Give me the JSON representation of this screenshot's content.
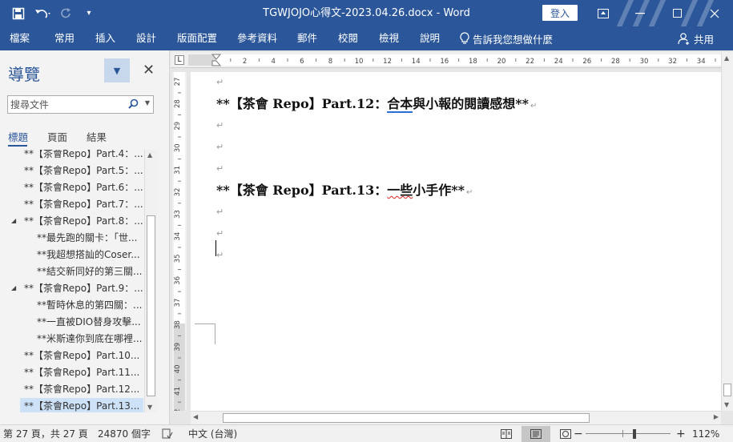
{
  "titlebar": {
    "title": "TGWJOJO心得文-2023.04.26.docx  -  Word",
    "login": "登入",
    "qat": {
      "save": "💾",
      "undo": "↶",
      "redo": "↷",
      "customize": "▾"
    }
  },
  "ribbon": {
    "tabs": [
      "檔案",
      "常用",
      "插入",
      "設計",
      "版面配置",
      "參考資料",
      "郵件",
      "校閱",
      "檢視",
      "說明"
    ],
    "tell_me": "告訴我您想做什麼",
    "share": "共用"
  },
  "nav": {
    "title": "導覽",
    "search_placeholder": "搜尋文件",
    "tabs": [
      "標題",
      "頁面",
      "結果"
    ],
    "items": [
      {
        "label": "**【茶會Repo】Part.4：...",
        "level": 1
      },
      {
        "label": "**【茶會Repo】Part.5：...",
        "level": 1
      },
      {
        "label": "**【茶會Repo】Part.6：...",
        "level": 1
      },
      {
        "label": "**【茶會Repo】Part.7：...",
        "level": 1
      },
      {
        "label": "**【茶會Repo】Part.8：...",
        "level": 1,
        "expanded": true
      },
      {
        "label": "**最先跑的關卡：「世...",
        "level": 2
      },
      {
        "label": "**我超想搭訕的Coser...",
        "level": 2
      },
      {
        "label": "**結交新同好的第三關...",
        "level": 2
      },
      {
        "label": "**【茶會Repo】Part.9：...",
        "level": 1,
        "expanded": true
      },
      {
        "label": "**暫時休息的第四關：...",
        "level": 2
      },
      {
        "label": "**一直被DIO替身攻擊...",
        "level": 2
      },
      {
        "label": "**米斯達你到底在哪裡...",
        "level": 2
      },
      {
        "label": "**【茶會Repo】Part.10...",
        "level": 1
      },
      {
        "label": "**【茶會Repo】Part.11...",
        "level": 1
      },
      {
        "label": "**【茶會Repo】Part.12...",
        "level": 1
      },
      {
        "label": "**【茶會Repo】Part.13...",
        "level": 1,
        "selected": true
      }
    ]
  },
  "ruler": {
    "h_labels": [
      "2",
      "4",
      "6",
      "8",
      "10",
      "12",
      "14",
      "16",
      "18",
      "20",
      "22",
      "24",
      "26",
      "28",
      "30",
      "32",
      "34"
    ],
    "v_labels": [
      "27",
      "28",
      "29",
      "30",
      "31",
      "32",
      "33",
      "34",
      "35",
      "36",
      "37",
      "38",
      "39",
      "40",
      "41",
      "42"
    ],
    "tab_marker": "L"
  },
  "document": {
    "para_mark": "↵",
    "heading12": {
      "prefix": "**【茶會 Repo】Part.12：",
      "underlined": "合本",
      "rest": "與小報的閱讀感想**"
    },
    "heading13": {
      "prefix": "**【茶會 Repo】Part.13：",
      "underlined": "一些",
      "rest": "小手作**"
    }
  },
  "status": {
    "page": "第 27 頁，共 27 頁",
    "words": "24870 個字",
    "language": "中文 (台灣)",
    "zoom": "112%",
    "zoom_minus": "−",
    "zoom_plus": "+"
  },
  "colors": {
    "brand": "#2b579a",
    "selection": "#cde1f7"
  }
}
